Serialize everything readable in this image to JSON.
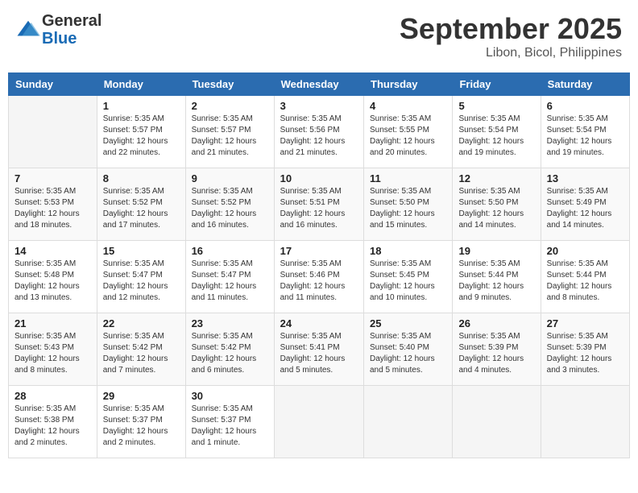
{
  "header": {
    "logo_general": "General",
    "logo_blue": "Blue",
    "month_title": "September 2025",
    "location": "Libon, Bicol, Philippines"
  },
  "weekdays": [
    "Sunday",
    "Monday",
    "Tuesday",
    "Wednesday",
    "Thursday",
    "Friday",
    "Saturday"
  ],
  "weeks": [
    [
      {
        "day": "",
        "info": ""
      },
      {
        "day": "1",
        "info": "Sunrise: 5:35 AM\nSunset: 5:57 PM\nDaylight: 12 hours\nand 22 minutes."
      },
      {
        "day": "2",
        "info": "Sunrise: 5:35 AM\nSunset: 5:57 PM\nDaylight: 12 hours\nand 21 minutes."
      },
      {
        "day": "3",
        "info": "Sunrise: 5:35 AM\nSunset: 5:56 PM\nDaylight: 12 hours\nand 21 minutes."
      },
      {
        "day": "4",
        "info": "Sunrise: 5:35 AM\nSunset: 5:55 PM\nDaylight: 12 hours\nand 20 minutes."
      },
      {
        "day": "5",
        "info": "Sunrise: 5:35 AM\nSunset: 5:54 PM\nDaylight: 12 hours\nand 19 minutes."
      },
      {
        "day": "6",
        "info": "Sunrise: 5:35 AM\nSunset: 5:54 PM\nDaylight: 12 hours\nand 19 minutes."
      }
    ],
    [
      {
        "day": "7",
        "info": "Sunrise: 5:35 AM\nSunset: 5:53 PM\nDaylight: 12 hours\nand 18 minutes."
      },
      {
        "day": "8",
        "info": "Sunrise: 5:35 AM\nSunset: 5:52 PM\nDaylight: 12 hours\nand 17 minutes."
      },
      {
        "day": "9",
        "info": "Sunrise: 5:35 AM\nSunset: 5:52 PM\nDaylight: 12 hours\nand 16 minutes."
      },
      {
        "day": "10",
        "info": "Sunrise: 5:35 AM\nSunset: 5:51 PM\nDaylight: 12 hours\nand 16 minutes."
      },
      {
        "day": "11",
        "info": "Sunrise: 5:35 AM\nSunset: 5:50 PM\nDaylight: 12 hours\nand 15 minutes."
      },
      {
        "day": "12",
        "info": "Sunrise: 5:35 AM\nSunset: 5:50 PM\nDaylight: 12 hours\nand 14 minutes."
      },
      {
        "day": "13",
        "info": "Sunrise: 5:35 AM\nSunset: 5:49 PM\nDaylight: 12 hours\nand 14 minutes."
      }
    ],
    [
      {
        "day": "14",
        "info": "Sunrise: 5:35 AM\nSunset: 5:48 PM\nDaylight: 12 hours\nand 13 minutes."
      },
      {
        "day": "15",
        "info": "Sunrise: 5:35 AM\nSunset: 5:47 PM\nDaylight: 12 hours\nand 12 minutes."
      },
      {
        "day": "16",
        "info": "Sunrise: 5:35 AM\nSunset: 5:47 PM\nDaylight: 12 hours\nand 11 minutes."
      },
      {
        "day": "17",
        "info": "Sunrise: 5:35 AM\nSunset: 5:46 PM\nDaylight: 12 hours\nand 11 minutes."
      },
      {
        "day": "18",
        "info": "Sunrise: 5:35 AM\nSunset: 5:45 PM\nDaylight: 12 hours\nand 10 minutes."
      },
      {
        "day": "19",
        "info": "Sunrise: 5:35 AM\nSunset: 5:44 PM\nDaylight: 12 hours\nand 9 minutes."
      },
      {
        "day": "20",
        "info": "Sunrise: 5:35 AM\nSunset: 5:44 PM\nDaylight: 12 hours\nand 8 minutes."
      }
    ],
    [
      {
        "day": "21",
        "info": "Sunrise: 5:35 AM\nSunset: 5:43 PM\nDaylight: 12 hours\nand 8 minutes."
      },
      {
        "day": "22",
        "info": "Sunrise: 5:35 AM\nSunset: 5:42 PM\nDaylight: 12 hours\nand 7 minutes."
      },
      {
        "day": "23",
        "info": "Sunrise: 5:35 AM\nSunset: 5:42 PM\nDaylight: 12 hours\nand 6 minutes."
      },
      {
        "day": "24",
        "info": "Sunrise: 5:35 AM\nSunset: 5:41 PM\nDaylight: 12 hours\nand 5 minutes."
      },
      {
        "day": "25",
        "info": "Sunrise: 5:35 AM\nSunset: 5:40 PM\nDaylight: 12 hours\nand 5 minutes."
      },
      {
        "day": "26",
        "info": "Sunrise: 5:35 AM\nSunset: 5:39 PM\nDaylight: 12 hours\nand 4 minutes."
      },
      {
        "day": "27",
        "info": "Sunrise: 5:35 AM\nSunset: 5:39 PM\nDaylight: 12 hours\nand 3 minutes."
      }
    ],
    [
      {
        "day": "28",
        "info": "Sunrise: 5:35 AM\nSunset: 5:38 PM\nDaylight: 12 hours\nand 2 minutes."
      },
      {
        "day": "29",
        "info": "Sunrise: 5:35 AM\nSunset: 5:37 PM\nDaylight: 12 hours\nand 2 minutes."
      },
      {
        "day": "30",
        "info": "Sunrise: 5:35 AM\nSunset: 5:37 PM\nDaylight: 12 hours\nand 1 minute."
      },
      {
        "day": "",
        "info": ""
      },
      {
        "day": "",
        "info": ""
      },
      {
        "day": "",
        "info": ""
      },
      {
        "day": "",
        "info": ""
      }
    ]
  ]
}
